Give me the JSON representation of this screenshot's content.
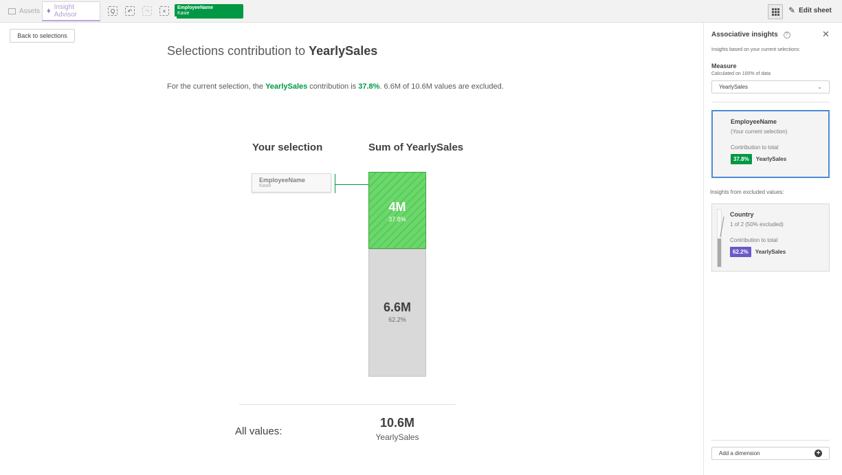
{
  "toolbar": {
    "assets_label": "Assets",
    "insight_label": "Insight Advisor",
    "selection_chip": {
      "title": "EmployeeName",
      "value": "Kasie"
    },
    "edit_sheet_label": "Edit sheet",
    "icons": [
      "smart-search-icon",
      "step-back-icon",
      "step-forward-icon",
      "clear-selections-icon",
      "grid-view-icon",
      "pencil-icon"
    ]
  },
  "main": {
    "back_label": "Back to selections",
    "title_prefix": "Selections contribution to ",
    "title_measure": "YearlySales",
    "summary": {
      "prefix": "For the current selection, the ",
      "measure": "YearlySales",
      "middle": " contribution is ",
      "percent": "37.8%",
      "suffix": ". 6.6M of 10.6M values are excluded."
    },
    "col_selection": "Your selection",
    "col_sum": "Sum of YearlySales",
    "selection_card": {
      "name": "EmployeeName",
      "value": "Kasie"
    },
    "all_values_label": "All values:",
    "all_values_total": "10.6M",
    "all_values_measure": "YearlySales"
  },
  "chart_data": {
    "type": "bar",
    "stacked": true,
    "categories": [
      "Sum of YearlySales"
    ],
    "series": [
      {
        "name": "selected",
        "value": 4.0,
        "value_label": "4M",
        "percent_label": "37.8%",
        "color": "#5cc85c"
      },
      {
        "name": "excluded",
        "value": 6.6,
        "value_label": "6.6M",
        "percent_label": "62.2%",
        "color": "#d9d9d9"
      }
    ],
    "total": 10.6,
    "unit": "M"
  },
  "panel": {
    "title": "Associative insights",
    "subtitle": "Insights based on your current selections:",
    "measure_heading": "Measure",
    "measure_sub": "Calculated on 100% of data",
    "measure_value": "YearlySales",
    "current_card": {
      "title": "EmployeeName",
      "subtitle": "(Your current selection)",
      "contribution_label": "Contribution to total",
      "badge": "37.8%",
      "badge_measure": "YearlySales"
    },
    "excluded_heading": "Insights from excluded values:",
    "excluded_card": {
      "title": "Country",
      "subtitle": "1 of 2 (50% excluded)",
      "contribution_label": "Contribution to total",
      "badge": "62.2%",
      "badge_measure": "YearlySales",
      "excluded_fraction": 0.5
    },
    "add_dimension_label": "Add a dimension"
  },
  "colors": {
    "accent_green": "#009845",
    "selection_blue": "#4c8bd4",
    "excluded_purple": "#6b58c9"
  }
}
